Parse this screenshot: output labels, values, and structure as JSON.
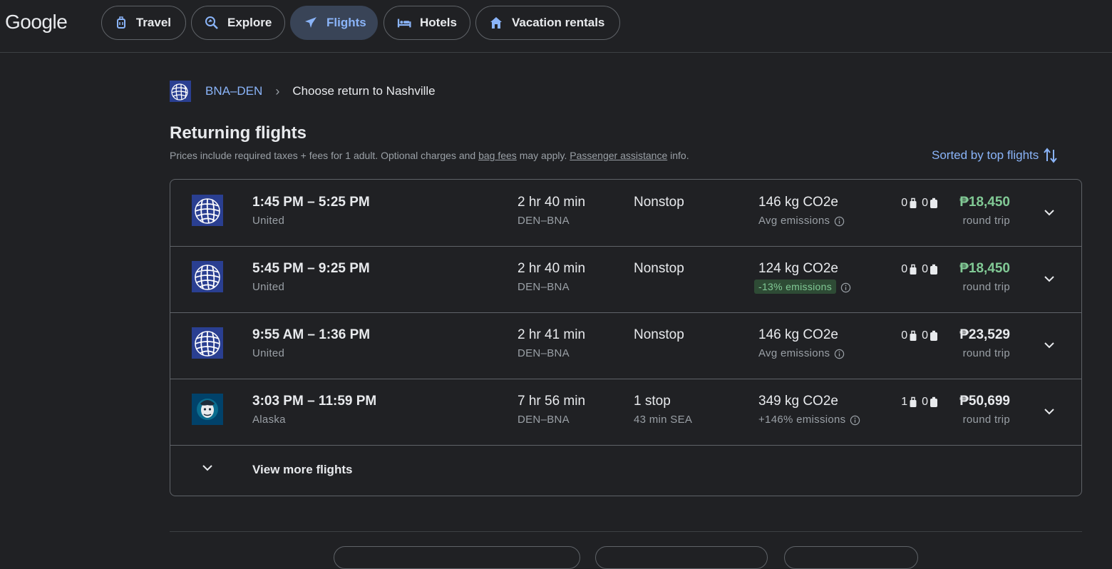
{
  "brand": "Google",
  "nav": {
    "tabs": [
      {
        "label": "Travel",
        "icon": "luggage-icon"
      },
      {
        "label": "Explore",
        "icon": "explore-icon"
      },
      {
        "label": "Flights",
        "icon": "airplane-icon",
        "active": true
      },
      {
        "label": "Hotels",
        "icon": "bed-icon"
      },
      {
        "label": "Vacation rentals",
        "icon": "house-icon"
      }
    ]
  },
  "breadcrumb": {
    "route": "BNA–DEN",
    "current": "Choose return to Nashville"
  },
  "section": {
    "title": "Returning flights",
    "note_prefix": "Prices include required taxes + fees for 1 adult. Optional charges and",
    "bag_fees_link": "bag fees",
    "note_middle": "may apply.",
    "assistance_link": "Passenger assistance",
    "note_suffix": "info.",
    "sort_label": "Sorted by top flights"
  },
  "flights": [
    {
      "times": "1:45 PM – 5:25 PM",
      "airline": "United",
      "duration": "2 hr 40 min",
      "route": "DEN–BNA",
      "stops": "Nonstop",
      "layover": "",
      "emissions": "146 kg CO2e",
      "emissions_note": "Avg emissions",
      "emissions_badge": false,
      "carry_on": "0",
      "checked": "0",
      "price": "₱18,450",
      "price_green": true,
      "price_note": "round trip"
    },
    {
      "times": "5:45 PM – 9:25 PM",
      "airline": "United",
      "duration": "2 hr 40 min",
      "route": "DEN–BNA",
      "stops": "Nonstop",
      "layover": "",
      "emissions": "124 kg CO2e",
      "emissions_note": "-13% emissions",
      "emissions_badge": true,
      "carry_on": "0",
      "checked": "0",
      "price": "₱18,450",
      "price_green": true,
      "price_note": "round trip"
    },
    {
      "times": "9:55 AM – 1:36 PM",
      "airline": "United",
      "duration": "2 hr 41 min",
      "route": "DEN–BNA",
      "stops": "Nonstop",
      "layover": "",
      "emissions": "146 kg CO2e",
      "emissions_note": "Avg emissions",
      "emissions_badge": false,
      "carry_on": "0",
      "checked": "0",
      "price": "₱23,529",
      "price_green": false,
      "price_note": "round trip"
    },
    {
      "times": "3:03 PM – 11:59 PM",
      "airline": "Alaska",
      "duration": "7 hr 56 min",
      "route": "DEN–BNA",
      "stops": "1 stop",
      "layover": "43 min SEA",
      "emissions": "349 kg CO2e",
      "emissions_note": "+146% emissions",
      "emissions_badge": false,
      "carry_on": "1",
      "checked": "0",
      "price": "₱50,699",
      "price_green": false,
      "price_note": "round trip"
    }
  ],
  "view_more": "View more flights",
  "colors": {
    "background": "#202124",
    "accent": "#8ab4f8",
    "good_price": "#81c995",
    "active_tab": "#394457",
    "border": "#5f6368"
  }
}
